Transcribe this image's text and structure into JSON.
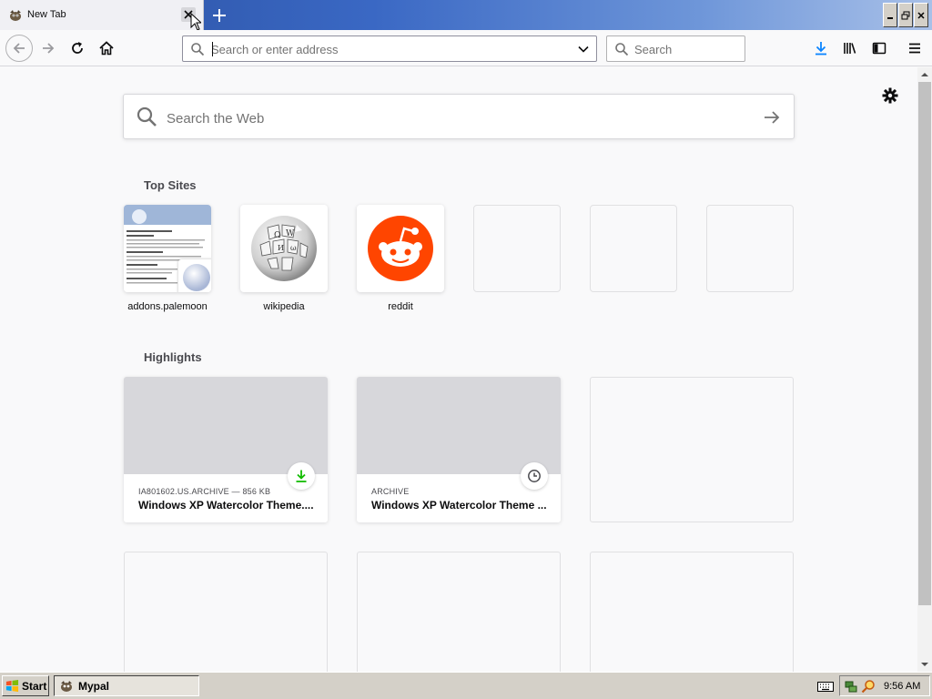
{
  "tab": {
    "title": "New Tab"
  },
  "navbar": {
    "url_placeholder": "Search or enter address",
    "search_placeholder": "Search"
  },
  "newtab": {
    "web_search_placeholder": "Search the Web",
    "top_sites_heading": "Top Sites",
    "top_sites": [
      {
        "label": "addons.palemoon",
        "icon": "palemoon-screenshot"
      },
      {
        "label": "wikipedia",
        "icon": "wikipedia-globe-icon"
      },
      {
        "label": "reddit",
        "icon": "reddit-icon"
      },
      {
        "label": "",
        "icon": "empty"
      },
      {
        "label": "",
        "icon": "empty"
      },
      {
        "label": "",
        "icon": "empty"
      }
    ],
    "highlights_heading": "Highlights",
    "highlights": [
      {
        "source": "IA801602.US.ARCHIVE — 856 KB",
        "title": "Windows XP Watercolor Theme....",
        "badge": "download-icon"
      },
      {
        "source": "ARCHIVE",
        "title": "Windows XP Watercolor Theme ...",
        "badge": "clock-icon"
      }
    ]
  },
  "taskbar": {
    "start_label": "Start",
    "task_label": "Mypal",
    "clock": "9:56 AM"
  },
  "colors": {
    "accent": "#0a84ff",
    "download_green": "#12bc00",
    "reddit_orange": "#ff4500",
    "titlebar_blue": "#2a4f9e"
  }
}
